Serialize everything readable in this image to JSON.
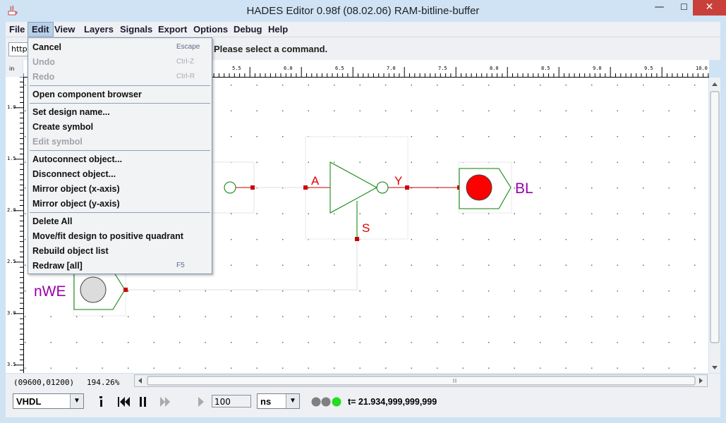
{
  "window": {
    "title": "HADES Editor 0.98f (08.02.06)   RAM-bitline-buffer",
    "minimize": "—",
    "maximize": "☐",
    "close": "✕"
  },
  "menubar": [
    "File",
    "Edit",
    "View",
    "Layers",
    "Signals",
    "Export",
    "Options",
    "Debug",
    "Help"
  ],
  "toolbar": {
    "url_value": "http:",
    "status": "Please select a command."
  },
  "edit_menu": [
    {
      "label": "Cancel",
      "accel": "Escape",
      "enabled": true
    },
    {
      "label": "Undo",
      "accel": "Ctrl-Z",
      "enabled": false
    },
    {
      "label": "Redo",
      "accel": "Ctrl-R",
      "enabled": false
    },
    {
      "separator": true
    },
    {
      "label": "Open component browser",
      "accel": "",
      "enabled": true
    },
    {
      "separator": true
    },
    {
      "label": "Set design name...",
      "accel": "",
      "enabled": true
    },
    {
      "label": "Create symbol",
      "accel": "",
      "enabled": true
    },
    {
      "label": "Edit symbol",
      "accel": "",
      "enabled": false
    },
    {
      "separator": true
    },
    {
      "label": "Autoconnect object...",
      "accel": "",
      "enabled": true
    },
    {
      "label": "Disconnect object...",
      "accel": "",
      "enabled": true
    },
    {
      "label": "Mirror object (x-axis)",
      "accel": "",
      "enabled": true
    },
    {
      "label": "Mirror object (y-axis)",
      "accel": "",
      "enabled": true
    },
    {
      "separator": true
    },
    {
      "label": "Delete All",
      "accel": "",
      "enabled": true
    },
    {
      "label": "Move/fit design to positive quadrant",
      "accel": "",
      "enabled": true
    },
    {
      "label": "Rebuild object list",
      "accel": "",
      "enabled": true
    },
    {
      "label": "Redraw [all]",
      "accel": "F5",
      "enabled": true
    }
  ],
  "ruler": {
    "corner": "in",
    "h_ticks": [
      "5.5",
      "6.0",
      "6.5",
      "7.0",
      "7.5",
      "8.0",
      "8.5",
      "9.0",
      "9.5",
      "10.0"
    ],
    "v_ticks": [
      "1.0",
      "1.5",
      "2.0",
      "2.5",
      "3.0",
      "3.5"
    ]
  },
  "schematic": {
    "labels": {
      "pin_a": "A",
      "pin_y": "Y",
      "pin_s": "S",
      "output": "BL",
      "input": "nWE"
    },
    "colors": {
      "wire": "#cc0000",
      "gate": "#008000",
      "label_red": "#e00000",
      "label_purple": "#9900aa",
      "led": "#ff0000"
    }
  },
  "statusbar": {
    "coords": "(09600,01200)",
    "zoom": "194.26%",
    "language": "VHDL",
    "time_value": "100",
    "time_unit": "ns",
    "sim_time": "t= 21.934,999,999,999"
  }
}
